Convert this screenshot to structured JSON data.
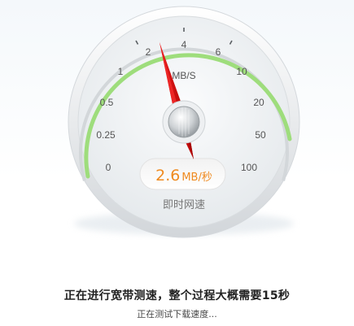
{
  "gauge": {
    "unit": "MB/S",
    "scale_labels": [
      "0",
      "0.25",
      "0.5",
      "1",
      "2",
      "4",
      "6",
      "10",
      "20",
      "50",
      "100"
    ],
    "reading": {
      "value": "2.6",
      "unit": "MB/秒"
    },
    "needle_value_mbps": 2.6,
    "caption": "即时网速",
    "colors": {
      "scale_arc": "#9edd7c",
      "needle": "#cc0a0a",
      "reading_value": "#ef8a1f"
    }
  },
  "status": {
    "message": "正在进行宽带测速，整个过程大概需要15秒",
    "submessage": "正在测试下载速度..."
  }
}
